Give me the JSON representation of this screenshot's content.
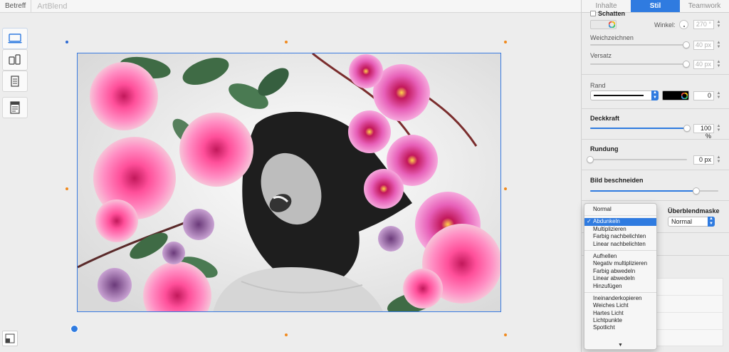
{
  "topbar": {
    "subject_label": "Betreff",
    "document_title": "ArtBlend"
  },
  "panel": {
    "tabs": [
      {
        "label": "Inhalte"
      },
      {
        "label": "Stil"
      },
      {
        "label": "Teamwork"
      }
    ],
    "shadow": {
      "label": "Schatten",
      "angle_label": "Winkel:",
      "angle_value": "270 °",
      "blur_label": "Weichzeichnen",
      "blur_value": "40 px",
      "offset_label": "Versatz",
      "offset_value": "40 px"
    },
    "border": {
      "label": "Rand",
      "width_value": "0"
    },
    "opacity": {
      "label": "Deckkraft",
      "value": "100 %",
      "level": 1.0
    },
    "rounding": {
      "label": "Rundung",
      "value": "0 px",
      "level": 0.0
    },
    "crop": {
      "label": "Bild beschneiden",
      "level": 0.83
    },
    "blend": {
      "mask_label": "Überblendmaske",
      "mask_value": "Normal"
    }
  },
  "blend_menu": {
    "items": [
      {
        "label": "Normal",
        "group": 0
      },
      {
        "label": "Abdunkeln",
        "group": 1,
        "selected": true
      },
      {
        "label": "Multiplizieren",
        "group": 1
      },
      {
        "label": "Farbig nachbelichten",
        "group": 1
      },
      {
        "label": "Linear nachbelichten",
        "group": 1
      },
      {
        "label": "Aufhellen",
        "group": 2
      },
      {
        "label": "Negativ multiplizieren",
        "group": 2
      },
      {
        "label": "Farbig abwedeln",
        "group": 2
      },
      {
        "label": "Linear abwedeln",
        "group": 2
      },
      {
        "label": "Hinzufügen",
        "group": 2
      },
      {
        "label": "Ineinanderkopieren",
        "group": 3
      },
      {
        "label": "Weiches Licht",
        "group": 3
      },
      {
        "label": "Hartes Licht",
        "group": 3
      },
      {
        "label": "Lichtpunkte",
        "group": 3
      },
      {
        "label": "Spotlicht",
        "group": 3
      }
    ],
    "scroll_down": "▼"
  },
  "colors": {
    "accent": "#2f7be0",
    "handle": "#f08a1e",
    "selection": "#3a7be0"
  },
  "icons": [
    "desktop-layout-icon",
    "mobile-layout-icon",
    "page-layout-icon",
    "template-layout-icon",
    "expand-icon",
    "rotate-handle-icon",
    "color-wheel-icon"
  ]
}
